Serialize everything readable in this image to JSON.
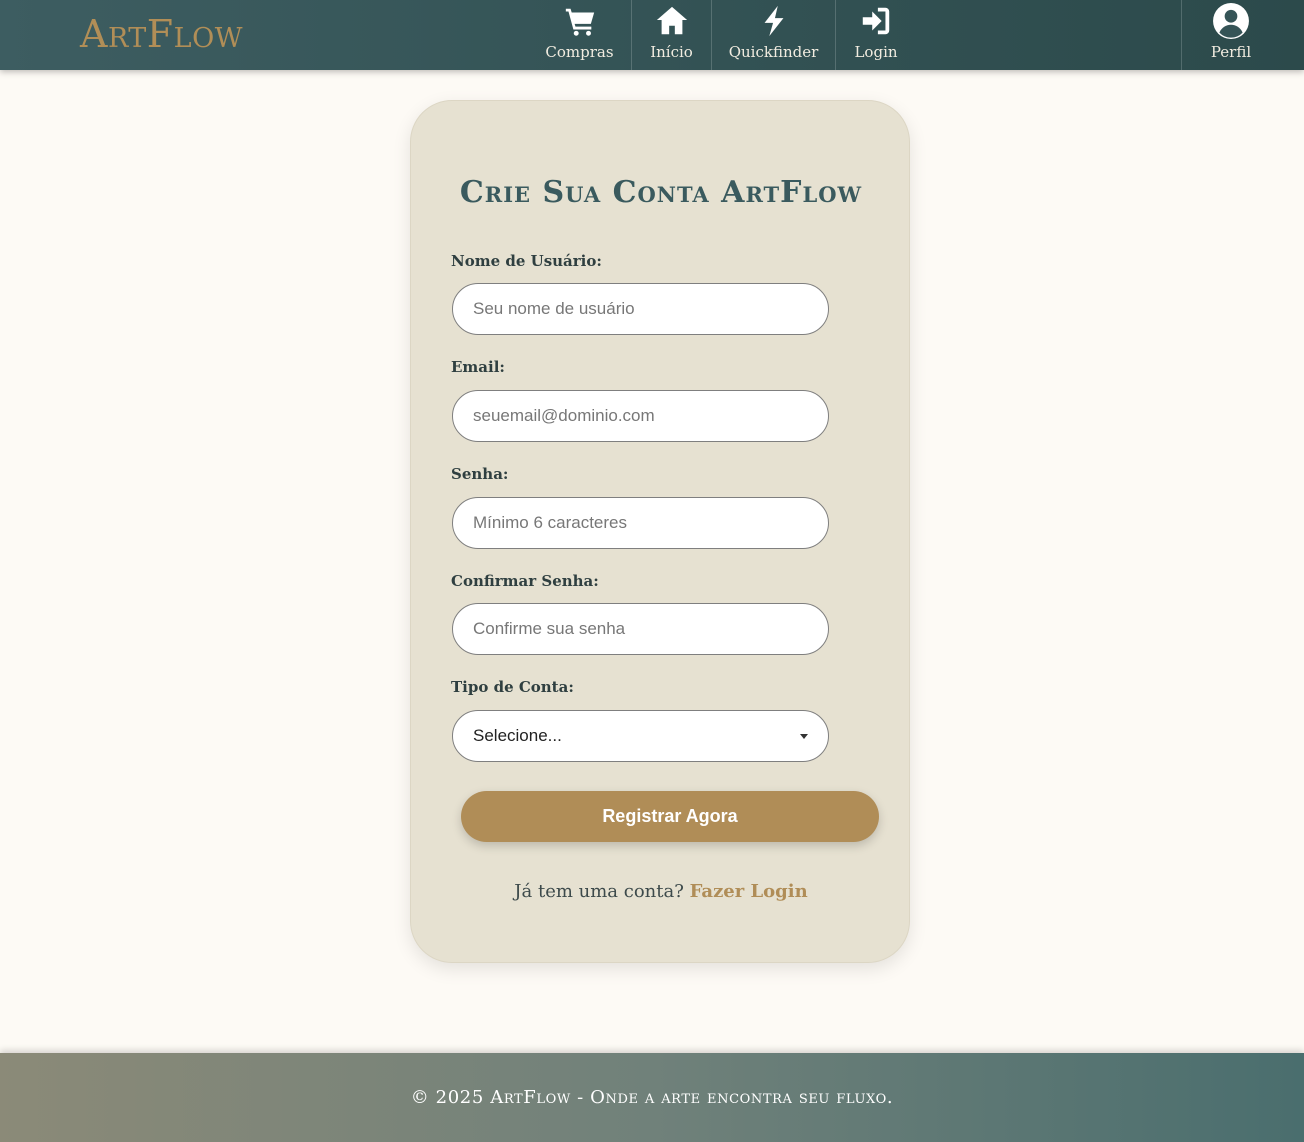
{
  "header": {
    "logo": "ArtFlow",
    "nav": [
      {
        "label": "Compras",
        "icon": "cart-icon"
      },
      {
        "label": "Início",
        "icon": "home-icon"
      },
      {
        "label": "Quickfinder",
        "icon": "bolt-icon"
      },
      {
        "label": "Login",
        "icon": "login-icon"
      }
    ],
    "profile": {
      "label": "Perfil",
      "icon": "user-circle-icon"
    }
  },
  "form": {
    "title": "Crie Sua Conta ArtFlow",
    "username": {
      "label": "Nome de Usuário:",
      "placeholder": "Seu nome de usuário",
      "value": ""
    },
    "email": {
      "label": "Email:",
      "placeholder": "seuemail@dominio.com",
      "value": ""
    },
    "password": {
      "label": "Senha:",
      "placeholder": "Mínimo 6 caracteres",
      "value": ""
    },
    "confirm": {
      "label": "Confirmar Senha:",
      "placeholder": "Confirme sua senha",
      "value": ""
    },
    "account_type": {
      "label": "Tipo de Conta:",
      "selected": "Selecione..."
    },
    "submit_label": "Registrar Agora",
    "login_prompt": "Já tem uma conta?",
    "login_link": "Fazer Login"
  },
  "footer": {
    "text": "© 2025 ArtFlow - Onde a arte encontra seu fluxo."
  },
  "colors": {
    "header_bg": "#355457",
    "brand_gold": "#b08d57",
    "card_bg": "#e6e1d1",
    "page_bg": "#fdfaf5",
    "title_teal": "#3a5a5e"
  }
}
